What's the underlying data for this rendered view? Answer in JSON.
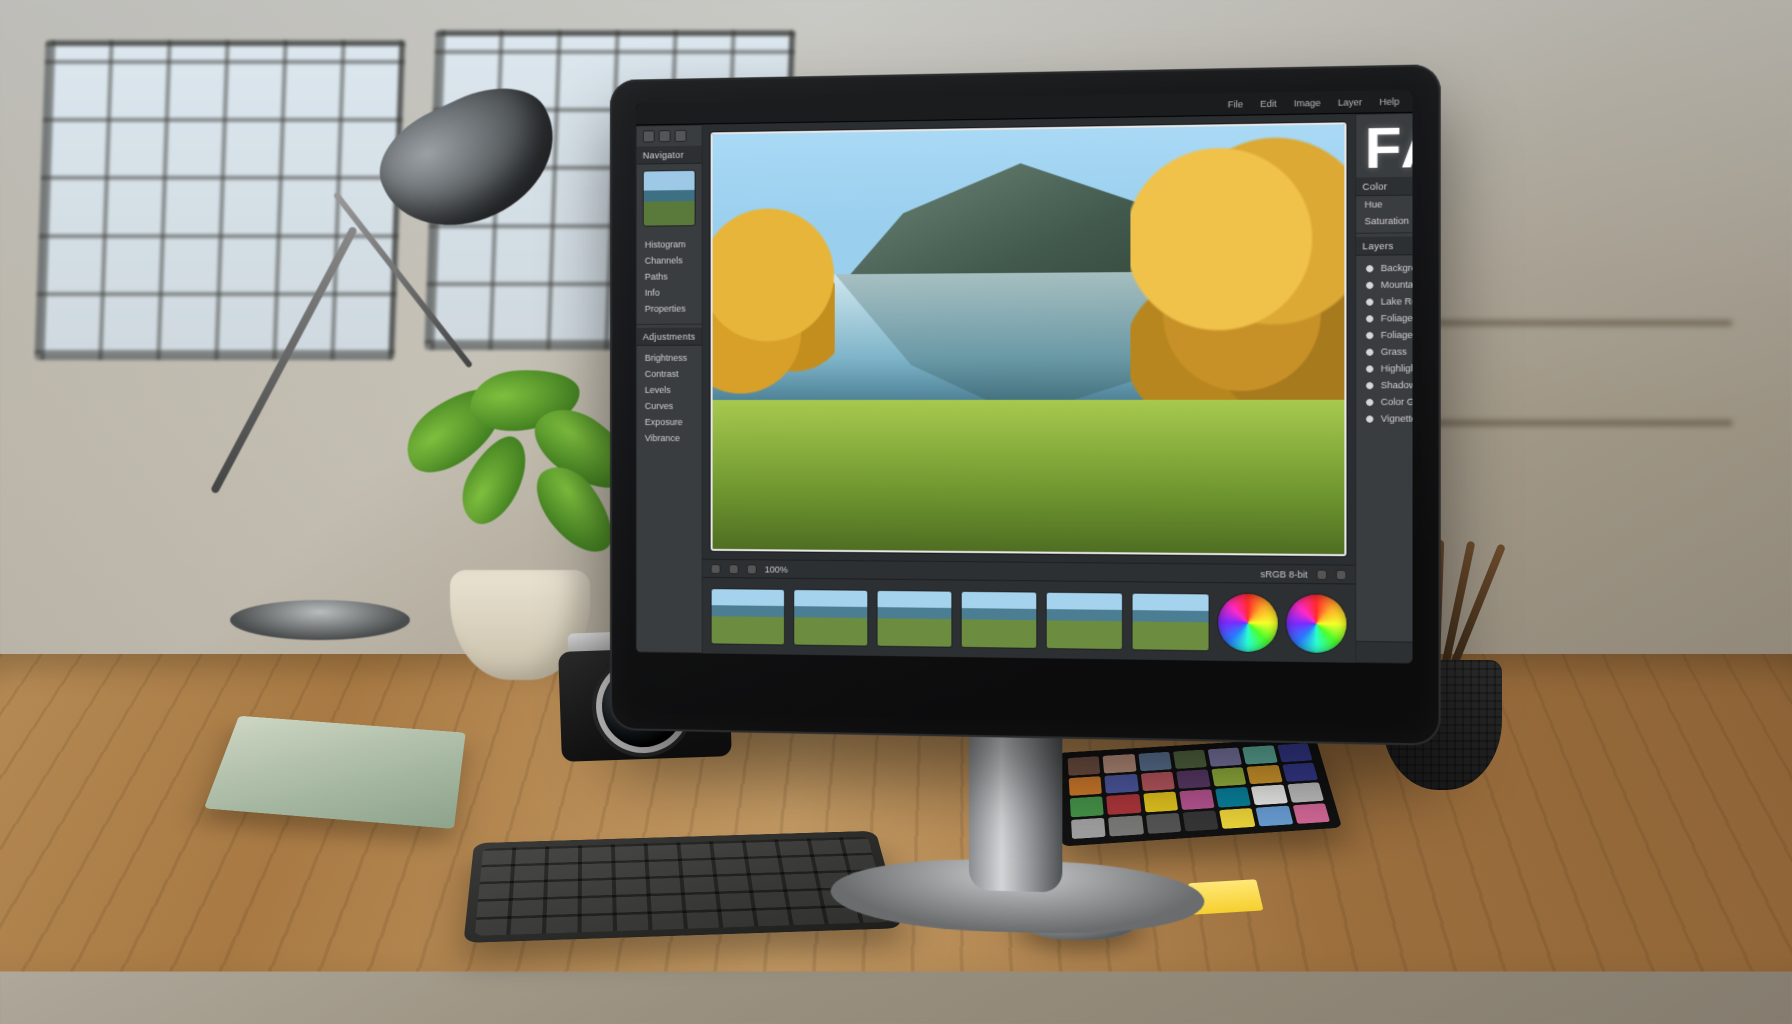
{
  "menubar": {
    "items": [
      "File",
      "Edit",
      "Image",
      "Layer",
      "Help"
    ]
  },
  "left_panel": {
    "header": "Navigator",
    "group1": [
      "Histogram",
      "Channels",
      "Paths",
      "Info",
      "Properties"
    ],
    "section": "Adjustments",
    "group2": [
      "Brightness",
      "Contrast",
      "Levels",
      "Curves",
      "Exposure",
      "Vibrance"
    ]
  },
  "right_panel": {
    "faq": "FAQ",
    "section1": "Color",
    "sliders": [
      {
        "label": "Hue"
      },
      {
        "label": "Saturation"
      }
    ],
    "section2": "Layers",
    "layers": [
      "Background",
      "Mountain",
      "Lake Reflection",
      "Foliage Left",
      "Foliage Right",
      "Grass",
      "Highlights",
      "Shadows",
      "Color Grade",
      "Vignette"
    ]
  },
  "status": {
    "left": "100%",
    "info": "sRGB  8-bit"
  },
  "filmstrip": {
    "count": 6
  },
  "checker_colors": [
    "#735244",
    "#c29682",
    "#627a9d",
    "#576c43",
    "#8580b1",
    "#67bdaa",
    "#383d96",
    "#d67e2c",
    "#505ba6",
    "#c15a63",
    "#5e3c6c",
    "#9dbc40",
    "#e0a32e",
    "#383d96",
    "#469449",
    "#af363c",
    "#e7c71f",
    "#bb5695",
    "#0885a1",
    "#f3f3f2",
    "#c8c8c8",
    "#a0a0a0",
    "#7a7a79",
    "#555555",
    "#363636",
    "#f0d83a",
    "#6aa0d8",
    "#d86a9a"
  ]
}
